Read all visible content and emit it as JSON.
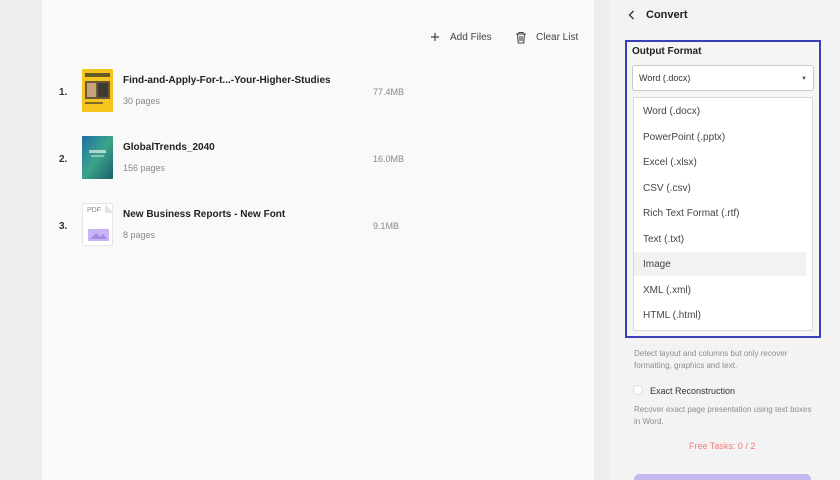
{
  "toolbar": {
    "add_files": "Add Files",
    "clear_list": "Clear List"
  },
  "files": [
    {
      "index": "1.",
      "name": "Find-and-Apply-For-t...-Your-Higher-Studies",
      "pages": "30 pages",
      "size": "77.4MB"
    },
    {
      "index": "2.",
      "name": "GlobalTrends_2040",
      "pages": "156 pages",
      "size": "16.0MB"
    },
    {
      "index": "3.",
      "name": "New Business Reports - New Font",
      "pages": "8 pages",
      "size": "9.1MB",
      "thumb_label": "PDF"
    }
  ],
  "panel": {
    "title": "Convert",
    "output_format_label": "Output Format",
    "selected": "Word (.docx)",
    "options": [
      "Word (.docx)",
      "PowerPoint (.pptx)",
      "Excel (.xlsx)",
      "CSV (.csv)",
      "Rich Text Format (.rtf)",
      "Text (.txt)",
      "Image",
      "XML (.xml)",
      "HTML (.html)"
    ],
    "hovered_option": "Image",
    "retain_desc_line1": "Detect layout and columns but only recover",
    "retain_desc_line2": "formatting, graphics and text.",
    "exact_label": "Exact Reconstruction",
    "exact_desc_line1": "Recover exact page presentation using text boxes",
    "exact_desc_line2": "in Word.",
    "free_tasks": "Free Tasks: 0 / 2"
  },
  "colors": {
    "accent_border": "#3a3fb5",
    "free_tasks": "#f07a7a",
    "convert_button": "#c5b8f0"
  },
  "icons": {
    "add": "plus-icon",
    "clear": "trash-icon",
    "back": "chevron-left-icon",
    "caret": "caret-down-icon"
  }
}
